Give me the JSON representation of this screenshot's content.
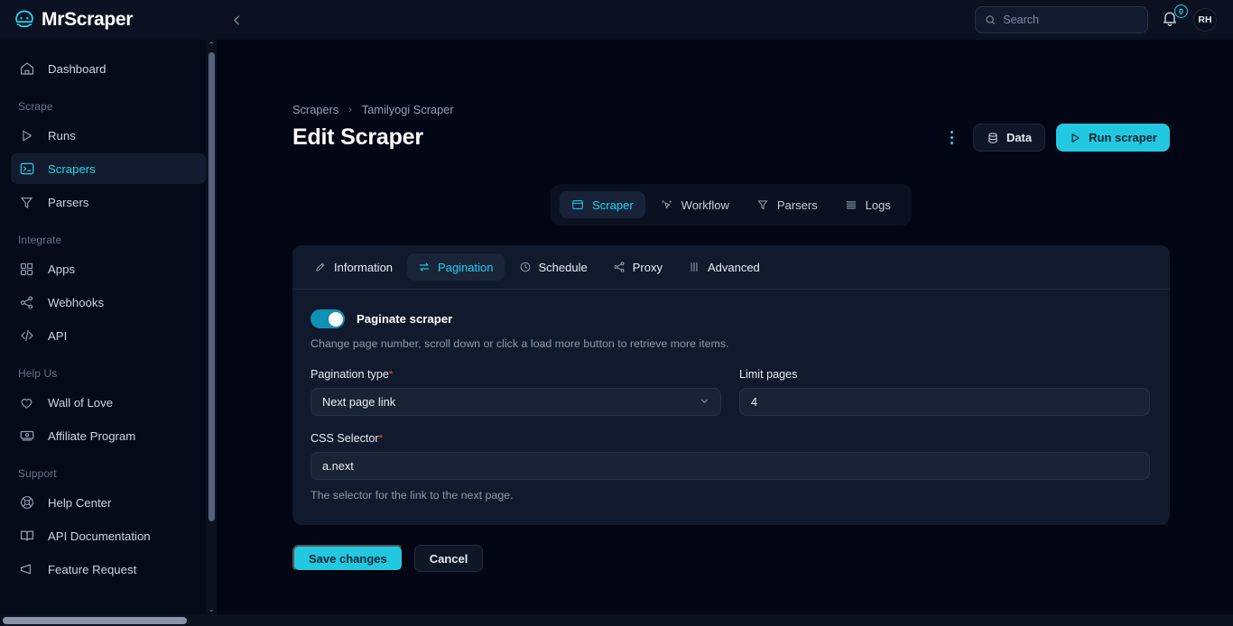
{
  "brand": {
    "name": "MrScraper",
    "logo_icon": "mrscraper-mask-logo"
  },
  "topbar": {
    "collapse_icon": "chevron-left-icon",
    "search": {
      "placeholder": "Search",
      "value": "",
      "icon": "search-icon"
    },
    "notifications": {
      "icon": "bell-icon",
      "count": "0"
    },
    "avatar": {
      "initials": "RH"
    }
  },
  "sidebar": {
    "items": [
      {
        "label": "Dashboard",
        "icon": "home-icon",
        "active": false
      },
      {
        "label": "Scrape",
        "type": "section"
      },
      {
        "label": "Runs",
        "icon": "play-icon",
        "active": false
      },
      {
        "label": "Scrapers",
        "icon": "terminal-icon",
        "active": true
      },
      {
        "label": "Parsers",
        "icon": "filter-icon",
        "active": false
      },
      {
        "label": "Integrate",
        "type": "section"
      },
      {
        "label": "Apps",
        "icon": "grid-icon",
        "active": false
      },
      {
        "label": "Webhooks",
        "icon": "share-icon",
        "active": false
      },
      {
        "label": "API",
        "icon": "code-icon",
        "active": false
      },
      {
        "label": "Help Us",
        "type": "section"
      },
      {
        "label": "Wall of Love",
        "icon": "heart-icon",
        "active": false
      },
      {
        "label": "Affiliate Program",
        "icon": "money-icon",
        "active": false
      },
      {
        "label": "Support",
        "type": "section"
      },
      {
        "label": "Help Center",
        "icon": "lifebuoy-icon",
        "active": false
      },
      {
        "label": "API Documentation",
        "icon": "book-icon",
        "active": false
      },
      {
        "label": "Feature Request",
        "icon": "megaphone-icon",
        "active": false
      }
    ],
    "sections": {
      "scrape": "Scrape",
      "integrate": "Integrate",
      "help_us": "Help Us",
      "support": "Support"
    },
    "nav": {
      "dashboard": "Dashboard",
      "runs": "Runs",
      "scrapers": "Scrapers",
      "parsers": "Parsers",
      "apps": "Apps",
      "webhooks": "Webhooks",
      "api": "API",
      "wall_of_love": "Wall of Love",
      "affiliate": "Affiliate Program",
      "help_center": "Help Center",
      "api_docs": "API Documentation",
      "feature_request": "Feature Request"
    }
  },
  "breadcrumb": {
    "root": "Scrapers",
    "separator": "›",
    "current": "Tamilyogi Scraper"
  },
  "page": {
    "title": "Edit Scraper"
  },
  "header_actions": {
    "kebab_icon": "more-vertical-icon",
    "data_label": "Data",
    "data_icon": "database-icon",
    "run_label": "Run scraper",
    "run_icon": "play-icon"
  },
  "main_tabs": [
    {
      "label": "Scraper",
      "icon": "window-icon",
      "active": true
    },
    {
      "label": "Workflow",
      "icon": "cursor-sparkle-icon",
      "active": false
    },
    {
      "label": "Parsers",
      "icon": "filter-icon",
      "active": false
    },
    {
      "label": "Logs",
      "icon": "lines-icon",
      "active": false
    }
  ],
  "card_tabs": [
    {
      "label": "Information",
      "icon": "pencil-square-icon",
      "active": false
    },
    {
      "label": "Pagination",
      "icon": "swap-arrows-icon",
      "active": true
    },
    {
      "label": "Schedule",
      "icon": "clock-icon",
      "active": false
    },
    {
      "label": "Proxy",
      "icon": "share-icon",
      "active": false
    },
    {
      "label": "Advanced",
      "icon": "sliders-icon",
      "active": false
    }
  ],
  "form": {
    "toggle": {
      "label": "Paginate scraper",
      "on": true
    },
    "toggle_hint": "Change page number, scroll down or click a load more button to retrieve more items.",
    "pagination_type": {
      "label": "Pagination type",
      "required_mark": "*",
      "value": "Next page link",
      "chevron_icon": "chevron-down-icon"
    },
    "limit_pages": {
      "label": "Limit pages",
      "value": "4"
    },
    "css_selector": {
      "label": "CSS Selector",
      "required_mark": "*",
      "value": "a.next",
      "help": "The selector for the link to the next page."
    },
    "save_label": "Save changes",
    "cancel_label": "Cancel"
  },
  "scrollbars": {
    "up_arrow": "⌃",
    "down_arrow": "⌄"
  }
}
